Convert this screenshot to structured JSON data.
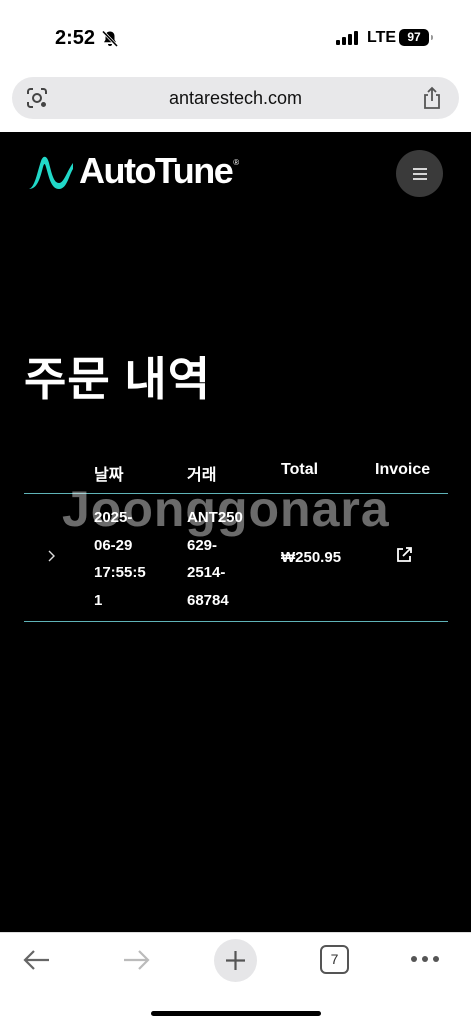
{
  "status_bar": {
    "time": "2:52",
    "network": "LTE",
    "battery": "97"
  },
  "browser": {
    "url": "antarestech.com",
    "tab_count": "7"
  },
  "site": {
    "logo_text": "AutoTune",
    "logo_reg": "®",
    "accent_color": "#21d8c8"
  },
  "page": {
    "title": "주문 내역"
  },
  "orders_table": {
    "columns": [
      "날짜",
      "거래",
      "Total",
      "Invoice"
    ],
    "rows": [
      {
        "date_lines": [
          "2025-",
          "06-29",
          "17:55:5",
          "1"
        ],
        "transaction_lines": [
          "ANT250",
          "629-",
          "2514-",
          "68784"
        ],
        "total": "₩250.95"
      }
    ]
  },
  "watermark": "Joonggonara",
  "icons": {
    "lens": "lens-icon",
    "share": "share-icon",
    "menu": "menu-icon",
    "chevron": "chevron-right-icon",
    "invoice": "external-link-icon",
    "back": "back-arrow-icon",
    "forward": "forward-arrow-icon",
    "new_tab": "plus-icon",
    "more": "more-icon",
    "bell": "bell-slash-icon"
  }
}
